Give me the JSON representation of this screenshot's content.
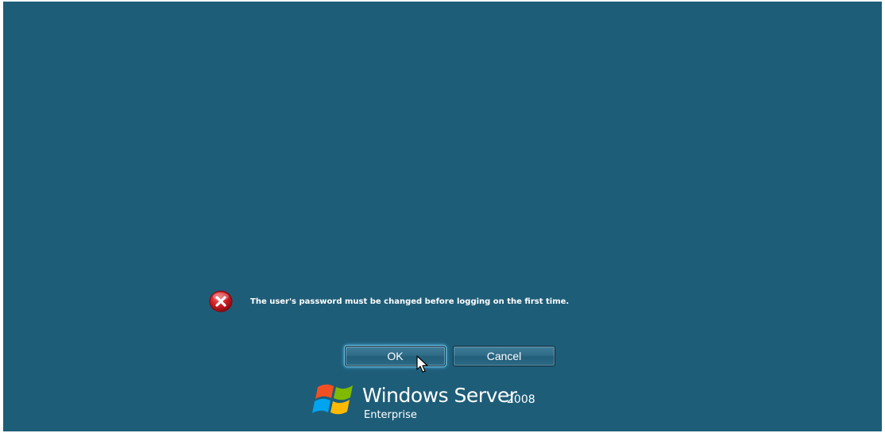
{
  "dialog": {
    "icon": "error-icon",
    "message": "The user's password must be changed before logging on the first time.",
    "ok_label": "OK",
    "cancel_label": "Cancel"
  },
  "branding": {
    "logo_icon": "windows-flag-icon",
    "name": "Windows Server",
    "year": "2008",
    "edition": "Enterprise"
  },
  "colors": {
    "background": "#1e5d78",
    "error_red": "#c8141c",
    "button_focus_glow": "#6fc8ee"
  }
}
